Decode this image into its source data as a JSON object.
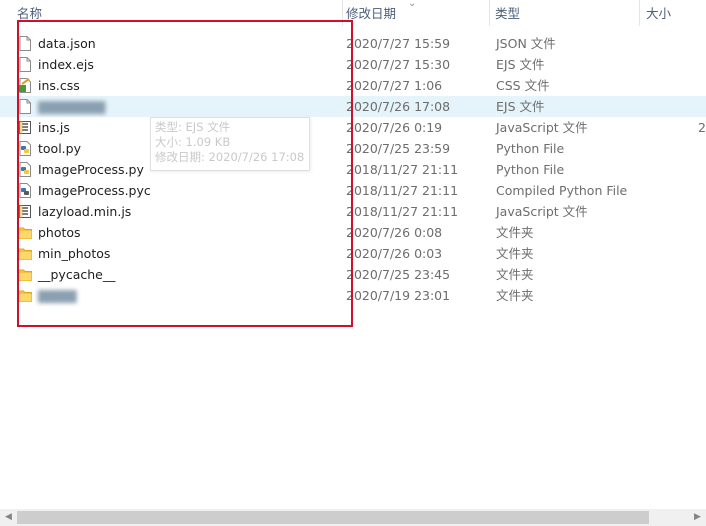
{
  "header": {
    "name_label": "名称",
    "date_label": "修改日期",
    "type_label": "类型",
    "size_label": "大小"
  },
  "rows": [
    {
      "name": "data.json",
      "date": "2020/7/27 15:59",
      "type": "JSON 文件",
      "size": "",
      "icon": "generic-file-icon"
    },
    {
      "name": "index.ejs",
      "date": "2020/7/27 15:30",
      "type": "EJS 文件",
      "size": "",
      "icon": "generic-file-icon"
    },
    {
      "name": "ins.css",
      "date": "2020/7/27 1:06",
      "type": "CSS 文件",
      "size": "",
      "icon": "css-file-icon"
    },
    {
      "name": "",
      "date": "2020/7/26 17:08",
      "type": "EJS 文件",
      "size": "",
      "icon": "generic-file-icon"
    },
    {
      "name": "ins.js",
      "date": "2020/7/26 0:19",
      "type": "JavaScript 文件",
      "size": "2",
      "icon": "js-file-icon"
    },
    {
      "name": "tool.py",
      "date": "2020/7/25 23:59",
      "type": "Python File",
      "size": "",
      "icon": "python-file-icon"
    },
    {
      "name": "ImageProcess.py",
      "date": "2018/11/27 21:11",
      "type": "Python File",
      "size": "",
      "icon": "python-file-icon"
    },
    {
      "name": "ImageProcess.pyc",
      "date": "2018/11/27 21:11",
      "type": "Compiled Python File",
      "size": "",
      "icon": "python-compiled-file-icon"
    },
    {
      "name": "lazyload.min.js",
      "date": "2018/11/27 21:11",
      "type": "JavaScript 文件",
      "size": "",
      "icon": "js-file-icon"
    },
    {
      "name": "photos",
      "date": "2020/7/26 0:08",
      "type": "文件夹",
      "size": "",
      "icon": "folder-icon"
    },
    {
      "name": "min_photos",
      "date": "2020/7/26 0:03",
      "type": "文件夹",
      "size": "",
      "icon": "folder-icon"
    },
    {
      "name": "__pycache__",
      "date": "2020/7/25 23:45",
      "type": "文件夹",
      "size": "",
      "icon": "folder-icon"
    },
    {
      "name": "",
      "date": "2020/7/19 23:01",
      "type": "文件夹",
      "size": "",
      "icon": "folder-icon"
    }
  ],
  "tooltip": {
    "line1": "类型: EJS 文件",
    "line2": "大小: 1.09 KB",
    "line3": "修改日期: 2020/7/26 17:08"
  },
  "colors": {
    "selection": "#e5f3fb",
    "highlight_box": "#d0102a",
    "folder": "#f7c244"
  }
}
